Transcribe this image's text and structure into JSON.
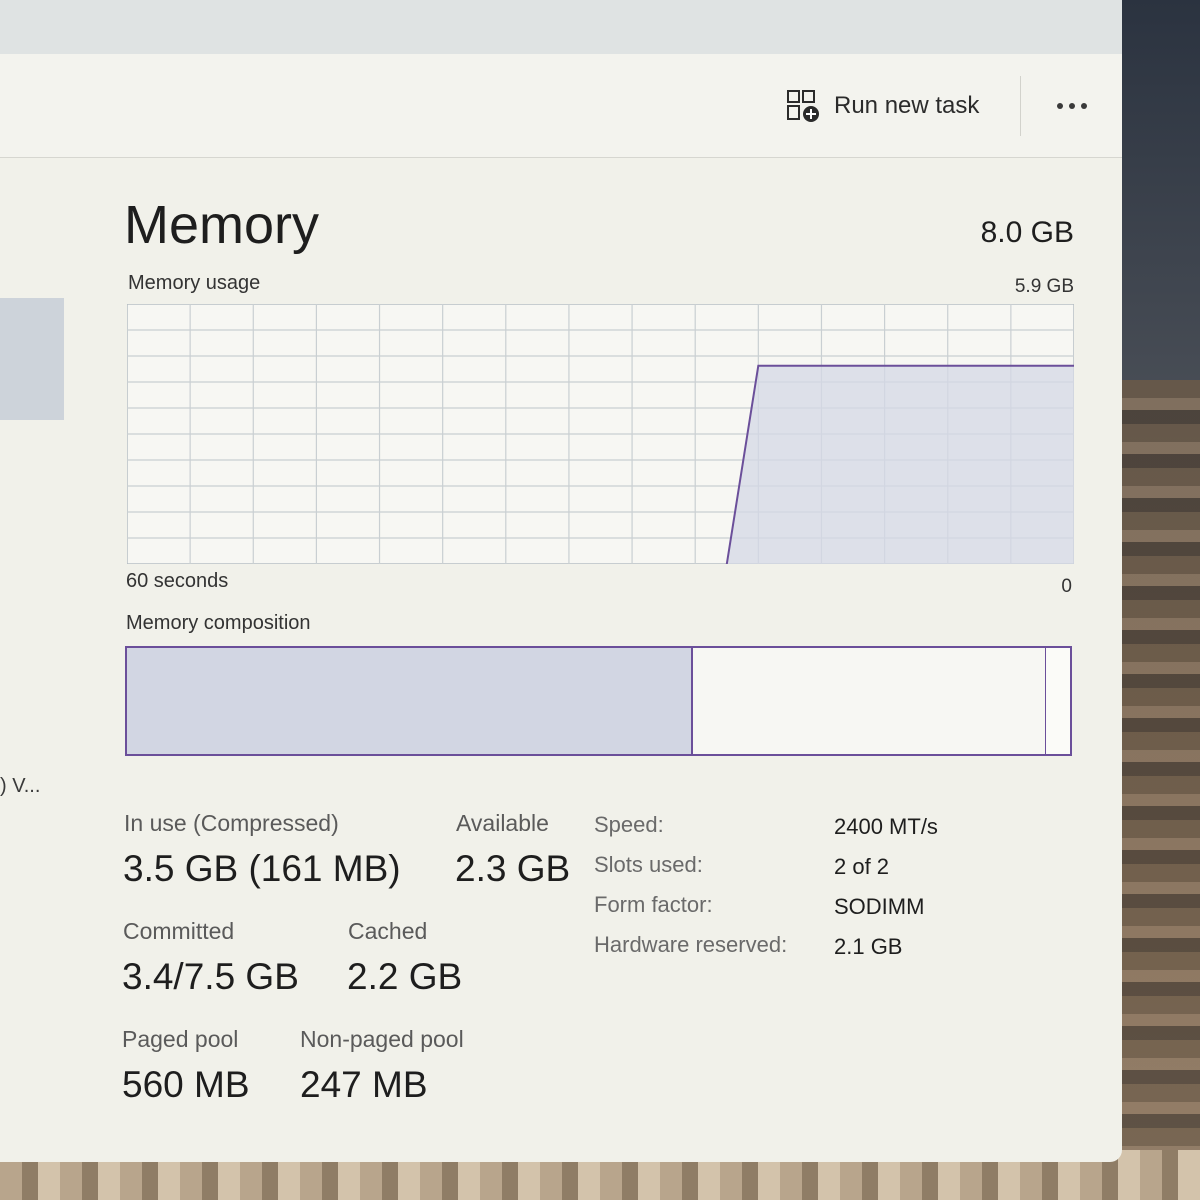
{
  "toolbar": {
    "run_new_task_label": "Run new task",
    "more_label": "More options"
  },
  "sidebar": {
    "truncated_item": ") V..."
  },
  "memory": {
    "title": "Memory",
    "total": "8.0 GB",
    "usage_label": "Memory usage",
    "usage_max": "5.9 GB",
    "graph_time_label": "60 seconds",
    "graph_min_label": "0",
    "composition_label": "Memory composition",
    "accent_color": "#6b4f9a"
  },
  "chart_data": {
    "type": "area",
    "title": "Memory usage",
    "xlabel": "60 seconds",
    "ylim": [
      0,
      5.9
    ],
    "y_unit": "GB",
    "x": [
      -60,
      -22,
      -20,
      0
    ],
    "values": [
      null,
      0,
      4.5,
      4.5
    ],
    "grid": true,
    "color": "#6b4f9a"
  },
  "composition": {
    "in_use_fraction": 0.6,
    "standby_fraction": 0.375,
    "free_fraction": 0.025
  },
  "stats": {
    "in_use_label": "In use (Compressed)",
    "in_use_value": "3.5 GB (161 MB)",
    "available_label": "Available",
    "available_value": "2.3 GB",
    "committed_label": "Committed",
    "committed_value": "3.4/7.5 GB",
    "cached_label": "Cached",
    "cached_value": "2.2 GB",
    "paged_label": "Paged pool",
    "paged_value": "560 MB",
    "nonpaged_label": "Non-paged pool",
    "nonpaged_value": "247 MB"
  },
  "properties": [
    {
      "label": "Speed:",
      "value": "2400 MT/s"
    },
    {
      "label": "Slots used:",
      "value": "2 of 2"
    },
    {
      "label": "Form factor:",
      "value": "SODIMM"
    },
    {
      "label": "Hardware reserved:",
      "value": "2.1 GB"
    }
  ]
}
